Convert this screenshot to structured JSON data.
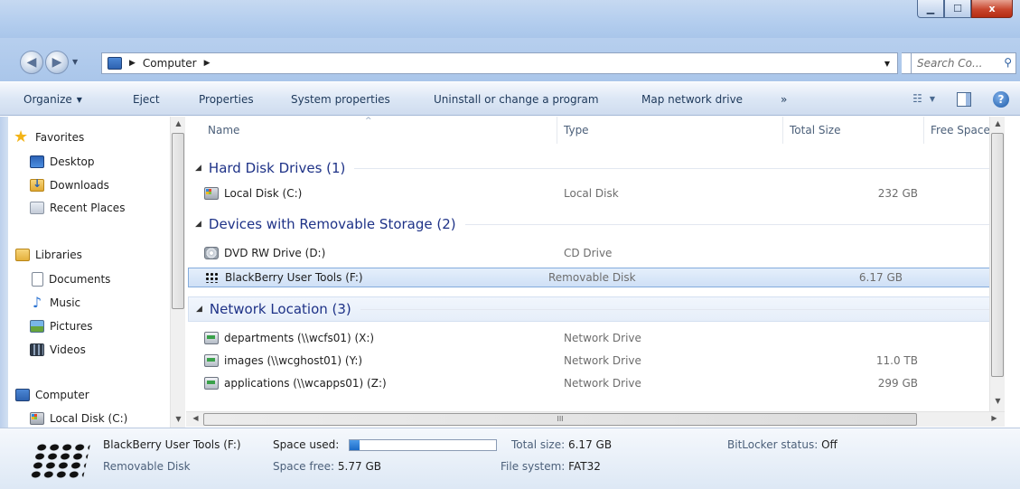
{
  "window": {
    "minimize_glyph": "▁",
    "maximize_glyph": "☐",
    "close_glyph": "x"
  },
  "address": {
    "back_glyph": "◀",
    "forward_glyph": "▶",
    "crumbs": [
      "Computer"
    ],
    "search_placeholder": "Search Co..."
  },
  "toolbar": {
    "organize": "Organize",
    "eject": "Eject",
    "properties": "Properties",
    "system_properties": "System properties",
    "uninstall": "Uninstall or change a program",
    "map_drive": "Map network drive",
    "more": "»",
    "help": "?"
  },
  "nav": {
    "favorites": "Favorites",
    "desktop": "Desktop",
    "downloads": "Downloads",
    "recent": "Recent Places",
    "libraries": "Libraries",
    "documents": "Documents",
    "music": "Music",
    "pictures": "Pictures",
    "videos": "Videos",
    "computer": "Computer",
    "local_disk": "Local Disk (C:)"
  },
  "columns": {
    "name": "Name",
    "type": "Type",
    "total": "Total Size",
    "free": "Free Space"
  },
  "groups": [
    {
      "title": "Hard Disk Drives (1)",
      "items": [
        {
          "name": "Local Disk (C:)",
          "type": "Local Disk",
          "size": "232 GB",
          "icon": "local-disk-icon"
        }
      ]
    },
    {
      "title": "Devices with Removable Storage (2)",
      "items": [
        {
          "name": "DVD RW Drive (D:)",
          "type": "CD Drive",
          "size": "",
          "icon": "dvd-drive-icon"
        },
        {
          "name": "BlackBerry User Tools (F:)",
          "type": "Removable Disk",
          "size": "6.17 GB",
          "icon": "blackberry-icon"
        }
      ]
    },
    {
      "title": "Network Location (3)",
      "items": [
        {
          "name": "departments (\\\\wcfs01) (X:)",
          "type": "Network Drive",
          "size": "",
          "icon": "network-drive-icon"
        },
        {
          "name": "images (\\\\wcghost01) (Y:)",
          "type": "Network Drive",
          "size": "11.0 TB",
          "icon": "network-drive-icon"
        },
        {
          "name": "applications (\\\\wcapps01) (Z:)",
          "type": "Network Drive",
          "size": "299 GB",
          "icon": "network-drive-icon"
        }
      ]
    }
  ],
  "details": {
    "name": "BlackBerry User Tools (F:)",
    "kind": "Removable Disk",
    "space_used_label": "Space used:",
    "space_used_fraction": 0.065,
    "space_free_label": "Space free:",
    "space_free_value": "5.77 GB",
    "total_size_label": "Total size:",
    "total_size_value": "6.17 GB",
    "file_system_label": "File system:",
    "file_system_value": "FAT32",
    "bitlocker_label": "BitLocker status:",
    "bitlocker_value": "Off"
  },
  "hscroll_glyph": "III"
}
